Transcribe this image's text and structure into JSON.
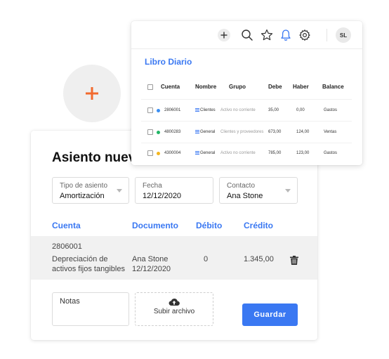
{
  "colors": {
    "accent": "#3a78f2",
    "plus": "#f26a2e",
    "dot_blue": "#3a8ef2",
    "dot_green": "#22b566",
    "dot_yellow": "#f3b61f"
  },
  "floating_action": {
    "icon": "plus-icon"
  },
  "asiento": {
    "title": "Asiento nuevo",
    "fields": [
      {
        "label": "Tipo de asiento",
        "value": "Amortización"
      },
      {
        "label": "Fecha",
        "value": "12/12/2020"
      },
      {
        "label": "Contacto",
        "value": "Ana Stone"
      }
    ],
    "columns": [
      "Cuenta",
      "Documento",
      "Débito",
      "Crédito"
    ],
    "row": {
      "account": "2806001",
      "description_1": "Depreciación de",
      "description_2": "activos fijos tangibles",
      "document_1": "Ana Stone",
      "document_2": "12/12/2020",
      "debit": "0",
      "credit": "1.345,00"
    },
    "notes_label": "Notas",
    "upload_label": "Subir archivo",
    "save_label": "Guardar"
  },
  "libro": {
    "title": "Libro Diario",
    "toolbar_icons": [
      "plus-icon",
      "search-icon",
      "star-icon",
      "bell-icon",
      "gear-icon"
    ],
    "avatar": "SL",
    "columns": [
      "Cuenta",
      "Nombre",
      "Grupo",
      "Debe",
      "Haber",
      "Balance"
    ],
    "rows": [
      {
        "cuenta": "2806001",
        "nombre": "Clientes",
        "grupo": "Activo no corriente",
        "debe": "35,00",
        "haber": "0,00",
        "balance": "Gastos",
        "dot": "blue"
      },
      {
        "cuenta": "4800283",
        "nombre": "General",
        "grupo": "Clientes y proveedores",
        "debe": "673,00",
        "haber": "124,00",
        "balance": "Ventas",
        "dot": "green"
      },
      {
        "cuenta": "4300004",
        "nombre": "General",
        "grupo": "Activo no corriente",
        "debe": "785,00",
        "haber": "123,00",
        "balance": "Gastos",
        "dot": "yellow"
      }
    ]
  }
}
